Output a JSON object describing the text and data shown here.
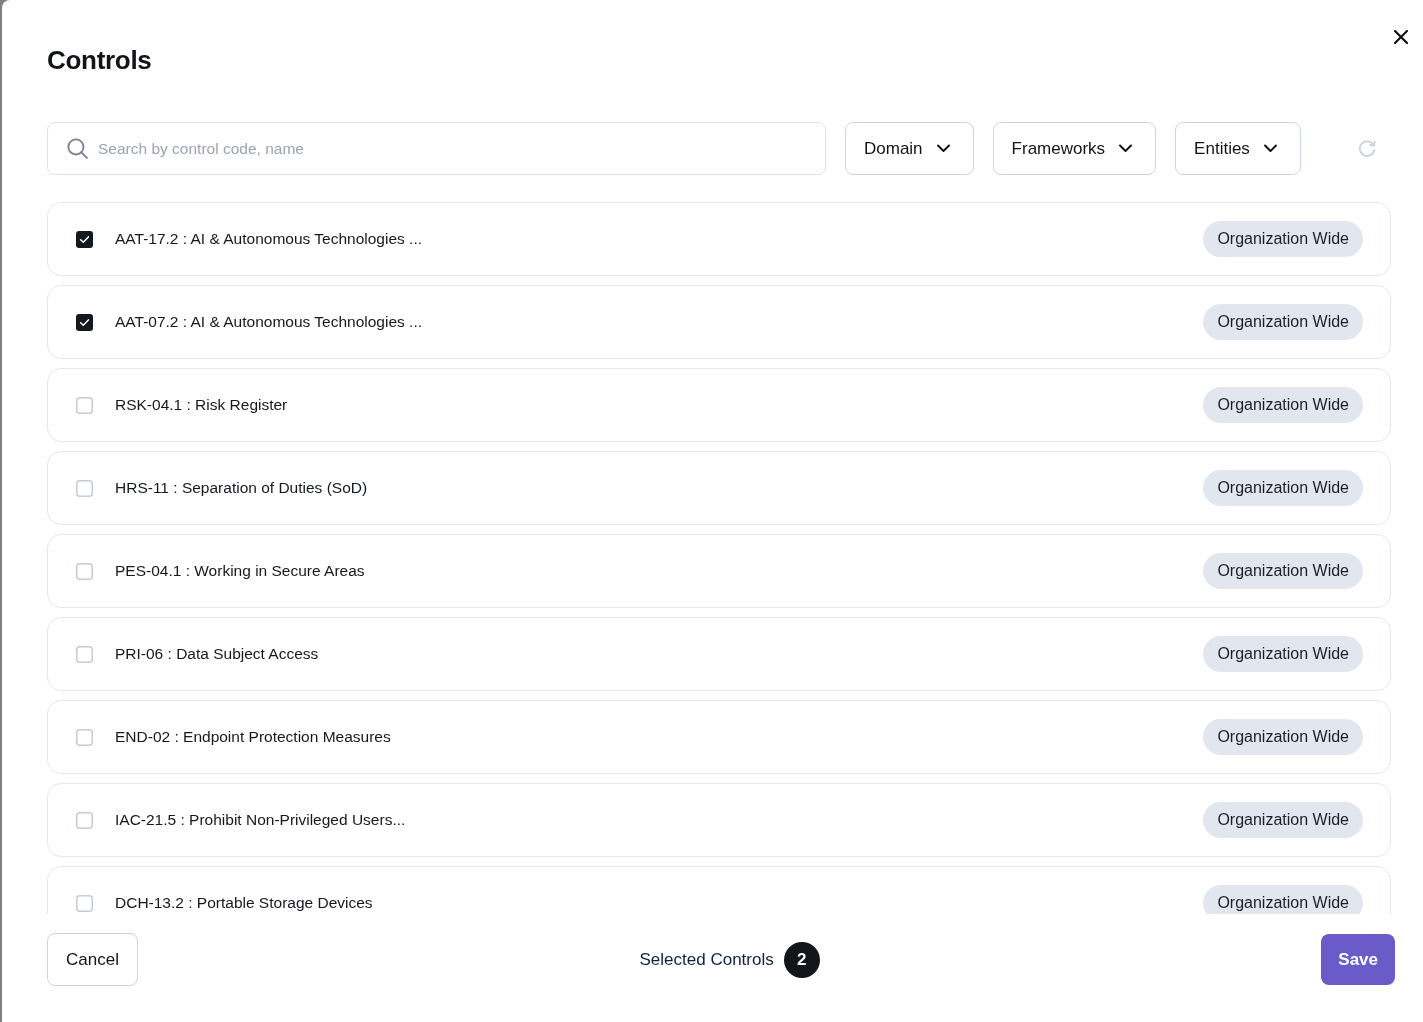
{
  "dialog": {
    "title": "Controls"
  },
  "filters": {
    "search": {
      "placeholder": "Search by control code, name"
    },
    "dropdowns": [
      {
        "label": "Domain"
      },
      {
        "label": "Frameworks"
      },
      {
        "label": "Entities"
      }
    ]
  },
  "controls": [
    {
      "label": "AAT-17.2 : AI & Autonomous Technologies ...",
      "checked": true,
      "scope": "Organization Wide"
    },
    {
      "label": "AAT-07.2 : AI & Autonomous Technologies ...",
      "checked": true,
      "scope": "Organization Wide"
    },
    {
      "label": "RSK-04.1 : Risk Register",
      "checked": false,
      "scope": "Organization Wide"
    },
    {
      "label": "HRS-11 : Separation of Duties (SoD)",
      "checked": false,
      "scope": "Organization Wide"
    },
    {
      "label": "PES-04.1 : Working in Secure Areas",
      "checked": false,
      "scope": "Organization Wide"
    },
    {
      "label": "PRI-06 : Data Subject Access",
      "checked": false,
      "scope": "Organization Wide"
    },
    {
      "label": "END-02 : Endpoint Protection Measures",
      "checked": false,
      "scope": "Organization Wide"
    },
    {
      "label": "IAC-21.5 : Prohibit Non-Privileged Users...",
      "checked": false,
      "scope": "Organization Wide"
    },
    {
      "label": "DCH-13.2 : Portable Storage Devices",
      "checked": false,
      "scope": "Organization Wide"
    }
  ],
  "footer": {
    "cancel": "Cancel",
    "selected_label": "Selected Controls",
    "selected_count": "2",
    "save": "Save"
  }
}
